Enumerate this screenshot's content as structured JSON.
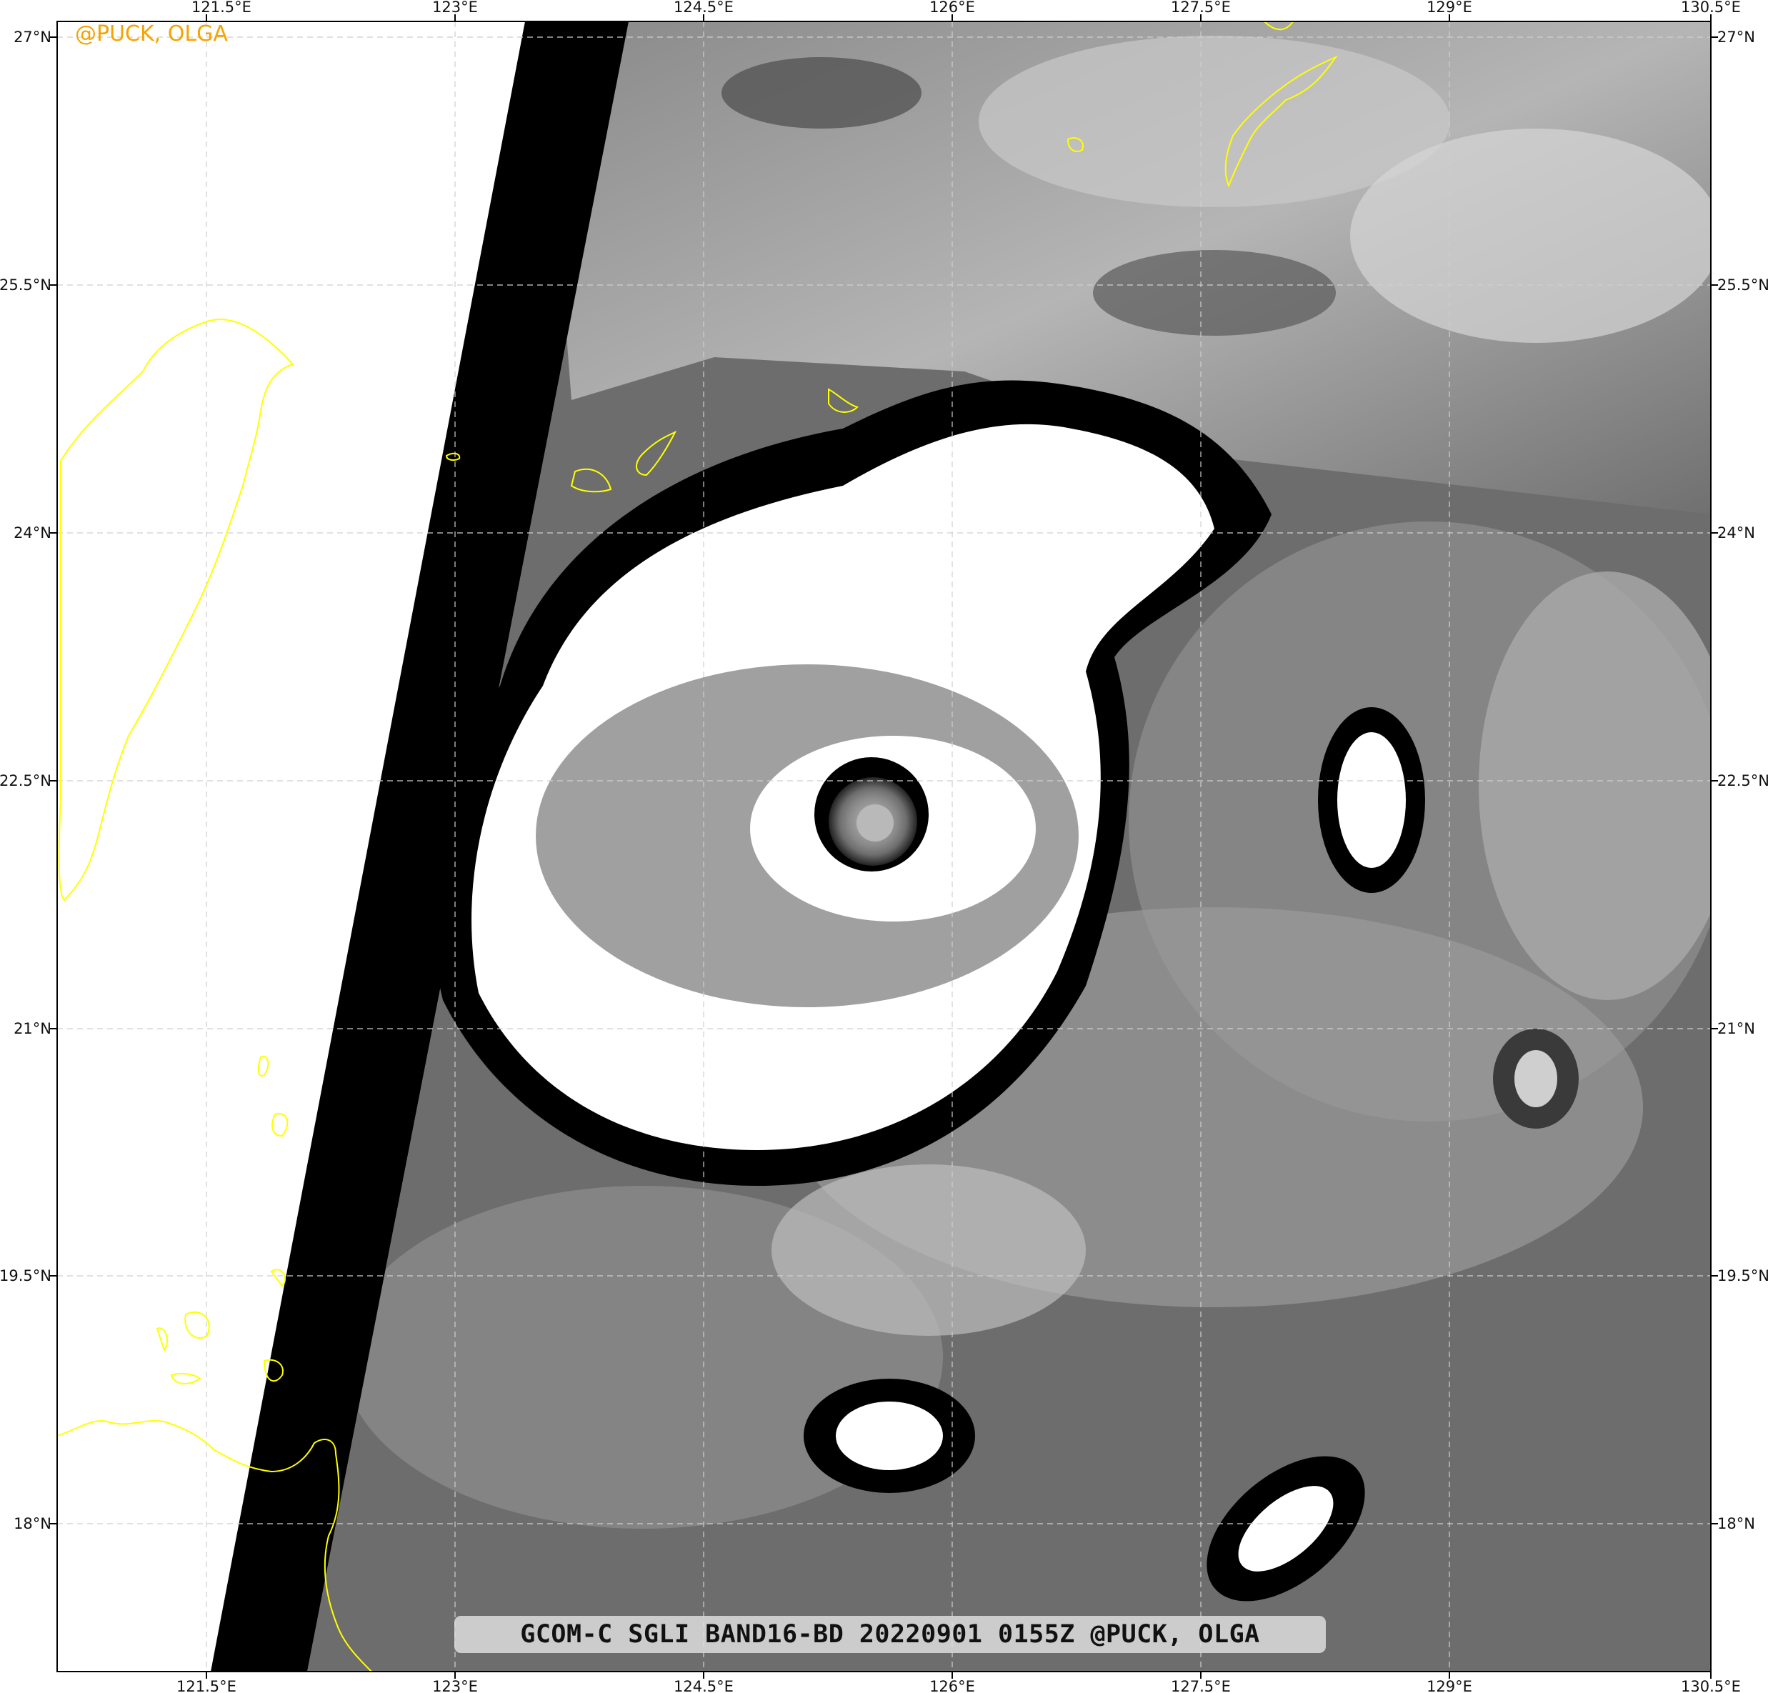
{
  "watermark": "@PUCK, OLGA",
  "caption": "GCOM-C SGLI BAND16-BD 20220901 0155Z @PUCK, OLGA",
  "longitude_ticks": [
    "121.5°E",
    "123°E",
    "124.5°E",
    "126°E",
    "127.5°E",
    "129°E",
    "130.5°E"
  ],
  "latitude_ticks": [
    "27°N",
    "25.5°N",
    "24°N",
    "22.5°N",
    "21°N",
    "19.5°N",
    "18°N"
  ],
  "colors": {
    "coastline": "#ffff00",
    "watermark": "#f5a300",
    "no_data_swath_edge": "#000000",
    "cloud_top_cold": "#ffffff",
    "gridline": "#cfcfcf"
  },
  "imagery": {
    "band": "BAND16-BD",
    "subject": "typhoon with clear eye",
    "eye_center": {
      "lon": 125.5,
      "lat": 22.2
    }
  }
}
